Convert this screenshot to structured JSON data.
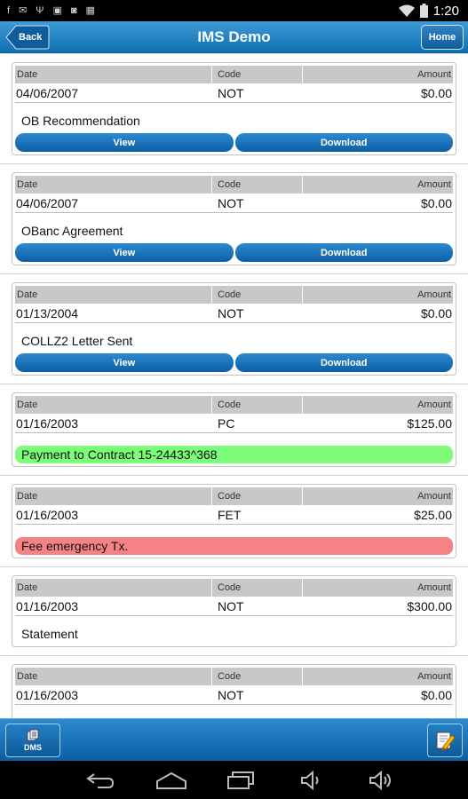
{
  "status": {
    "time": "1:20"
  },
  "header": {
    "title": "IMS Demo",
    "back_label": "Back",
    "home_label": "Home"
  },
  "columns": {
    "date": "Date",
    "code": "Code",
    "amount": "Amount"
  },
  "buttons": {
    "view": "View",
    "download": "Download"
  },
  "records": [
    {
      "date": "04/06/2007",
      "code": "NOT",
      "amount": "$0.00",
      "description": "OB Recommendation",
      "style": "plain-buttons"
    },
    {
      "date": "04/06/2007",
      "code": "NOT",
      "amount": "$0.00",
      "description": "OBanc Agreement",
      "style": "plain-buttons"
    },
    {
      "date": "01/13/2004",
      "code": "NOT",
      "amount": "$0.00",
      "description": "COLLZ2 Letter Sent",
      "style": "plain-buttons"
    },
    {
      "date": "01/16/2003",
      "code": "PC",
      "amount": "$125.00",
      "description": "Payment to Contract 15-24433^368",
      "style": "green"
    },
    {
      "date": "01/16/2003",
      "code": "FET",
      "amount": "$25.00",
      "description": "Fee emergency Tx.",
      "style": "red"
    },
    {
      "date": "01/16/2003",
      "code": "NOT",
      "amount": "$300.00",
      "description": "Statement",
      "style": "plain"
    },
    {
      "date": "01/16/2003",
      "code": "NOT",
      "amount": "$0.00",
      "description": "",
      "style": "plain"
    }
  ],
  "toolbar": {
    "dms_label": "DMS"
  },
  "colors": {
    "accent": "#0f6fb1",
    "green": "#7dfc7a",
    "red": "#f58285"
  }
}
